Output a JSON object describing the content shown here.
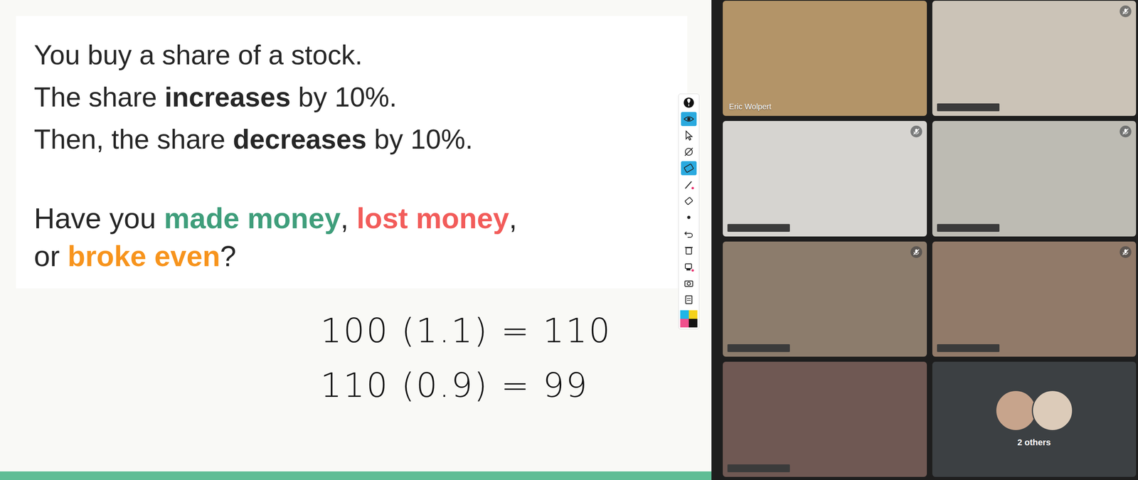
{
  "slide": {
    "lines": [
      [
        {
          "text": "You buy a share of a stock.",
          "bold": false
        }
      ],
      [
        {
          "text": "The share ",
          "bold": false
        },
        {
          "text": "increases",
          "bold": true
        },
        {
          "text": " by 10%.",
          "bold": false
        }
      ],
      [
        {
          "text": "Then, the share ",
          "bold": false
        },
        {
          "text": "decreases",
          "bold": true
        },
        {
          "text": " by 10%.",
          "bold": false
        }
      ]
    ],
    "question": [
      [
        {
          "text": "Have you ",
          "color": "#262626"
        },
        {
          "text": "made money",
          "color": "#3f9e7b"
        },
        {
          "text": ", ",
          "color": "#262626"
        },
        {
          "text": "lost money",
          "color": "#f25c5a"
        },
        {
          "text": ",",
          "color": "#262626"
        }
      ],
      [
        {
          "text": "or ",
          "color": "#262626"
        },
        {
          "text": "broke even",
          "color": "#f7941d"
        },
        {
          "text": "?",
          "color": "#262626"
        }
      ]
    ],
    "work": [
      "100 (1.1) = 110",
      "110 (0.9) = 99"
    ]
  },
  "toolbar": {
    "tools": [
      {
        "kind": "logo",
        "selected": false
      },
      {
        "kind": "eye",
        "selected": true
      },
      {
        "kind": "pointer",
        "selected": false
      },
      {
        "kind": "hide",
        "selected": false
      },
      {
        "kind": "tablet",
        "selected": true
      },
      {
        "kind": "pen",
        "selected": false
      },
      {
        "kind": "eraser",
        "selected": false
      },
      {
        "kind": "dot",
        "selected": false
      },
      {
        "kind": "undo",
        "selected": false
      },
      {
        "kind": "trash",
        "selected": false
      },
      {
        "kind": "stamp",
        "selected": false
      },
      {
        "kind": "camera",
        "selected": false
      },
      {
        "kind": "clipboard",
        "selected": false
      }
    ],
    "swatches": [
      {
        "color": "#1fb6e8"
      },
      {
        "color": "#f5d21c"
      },
      {
        "color": "#f04f8c"
      },
      {
        "color": "#111111"
      }
    ]
  },
  "participants": [
    {
      "label": "Eric Wolpert",
      "label_redacted": false,
      "muted": false,
      "color": "#b39468"
    },
    {
      "label": "",
      "label_redacted": true,
      "muted": true,
      "color": "#cbc3b7"
    },
    {
      "label": "",
      "label_redacted": true,
      "muted": true,
      "color": "#d6d4d0"
    },
    {
      "label": "",
      "label_redacted": true,
      "muted": true,
      "color": "#bdbbb3"
    },
    {
      "label": "",
      "label_redacted": true,
      "muted": true,
      "color": "#8c7c6c"
    },
    {
      "label": "",
      "label_redacted": true,
      "muted": true,
      "color": "#917a69"
    },
    {
      "label": "",
      "label_redacted": true,
      "muted": false,
      "color": "#6f5853"
    }
  ],
  "others": {
    "label": "2 others",
    "avatars": [
      {
        "color": "#c7a48c"
      },
      {
        "color": "#dccbb9"
      }
    ]
  }
}
